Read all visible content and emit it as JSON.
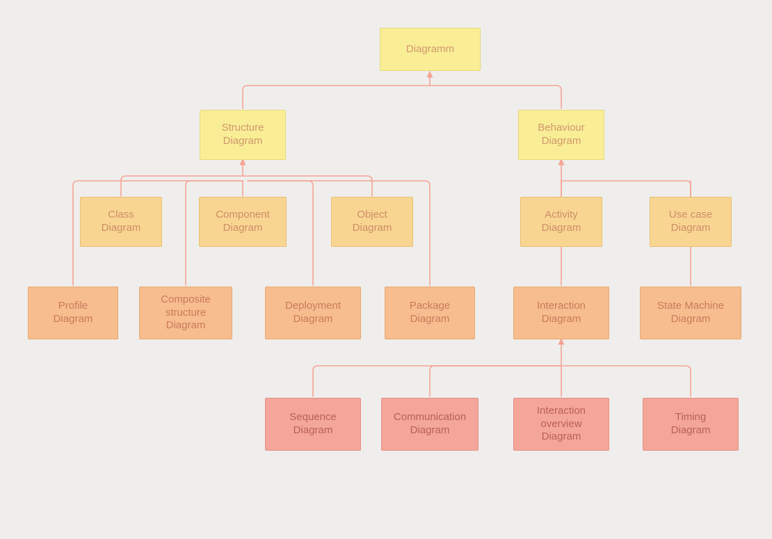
{
  "nodes": {
    "root": "Diagramm",
    "structure": "Structure\nDiagram",
    "behaviour": "Behaviour\nDiagram",
    "class": "Class\nDiagram",
    "component": "Component\nDiagram",
    "object": "Object\nDiagram",
    "activity": "Activity\nDiagram",
    "usecase": "Use case\nDiagram",
    "profile": "Profile\nDiagram",
    "composite": "Composite\nstructure\nDiagram",
    "deployment": "Deployment\nDiagram",
    "package": "Package\nDiagram",
    "interaction": "Interaction\nDiagram",
    "statemachine": "State Machine\nDiagram",
    "sequence": "Sequence\nDiagram",
    "communication": "Communication\nDiagram",
    "intoverview": "Interaction\noverview\nDiagram",
    "timing": "Timing\nDiagram"
  }
}
